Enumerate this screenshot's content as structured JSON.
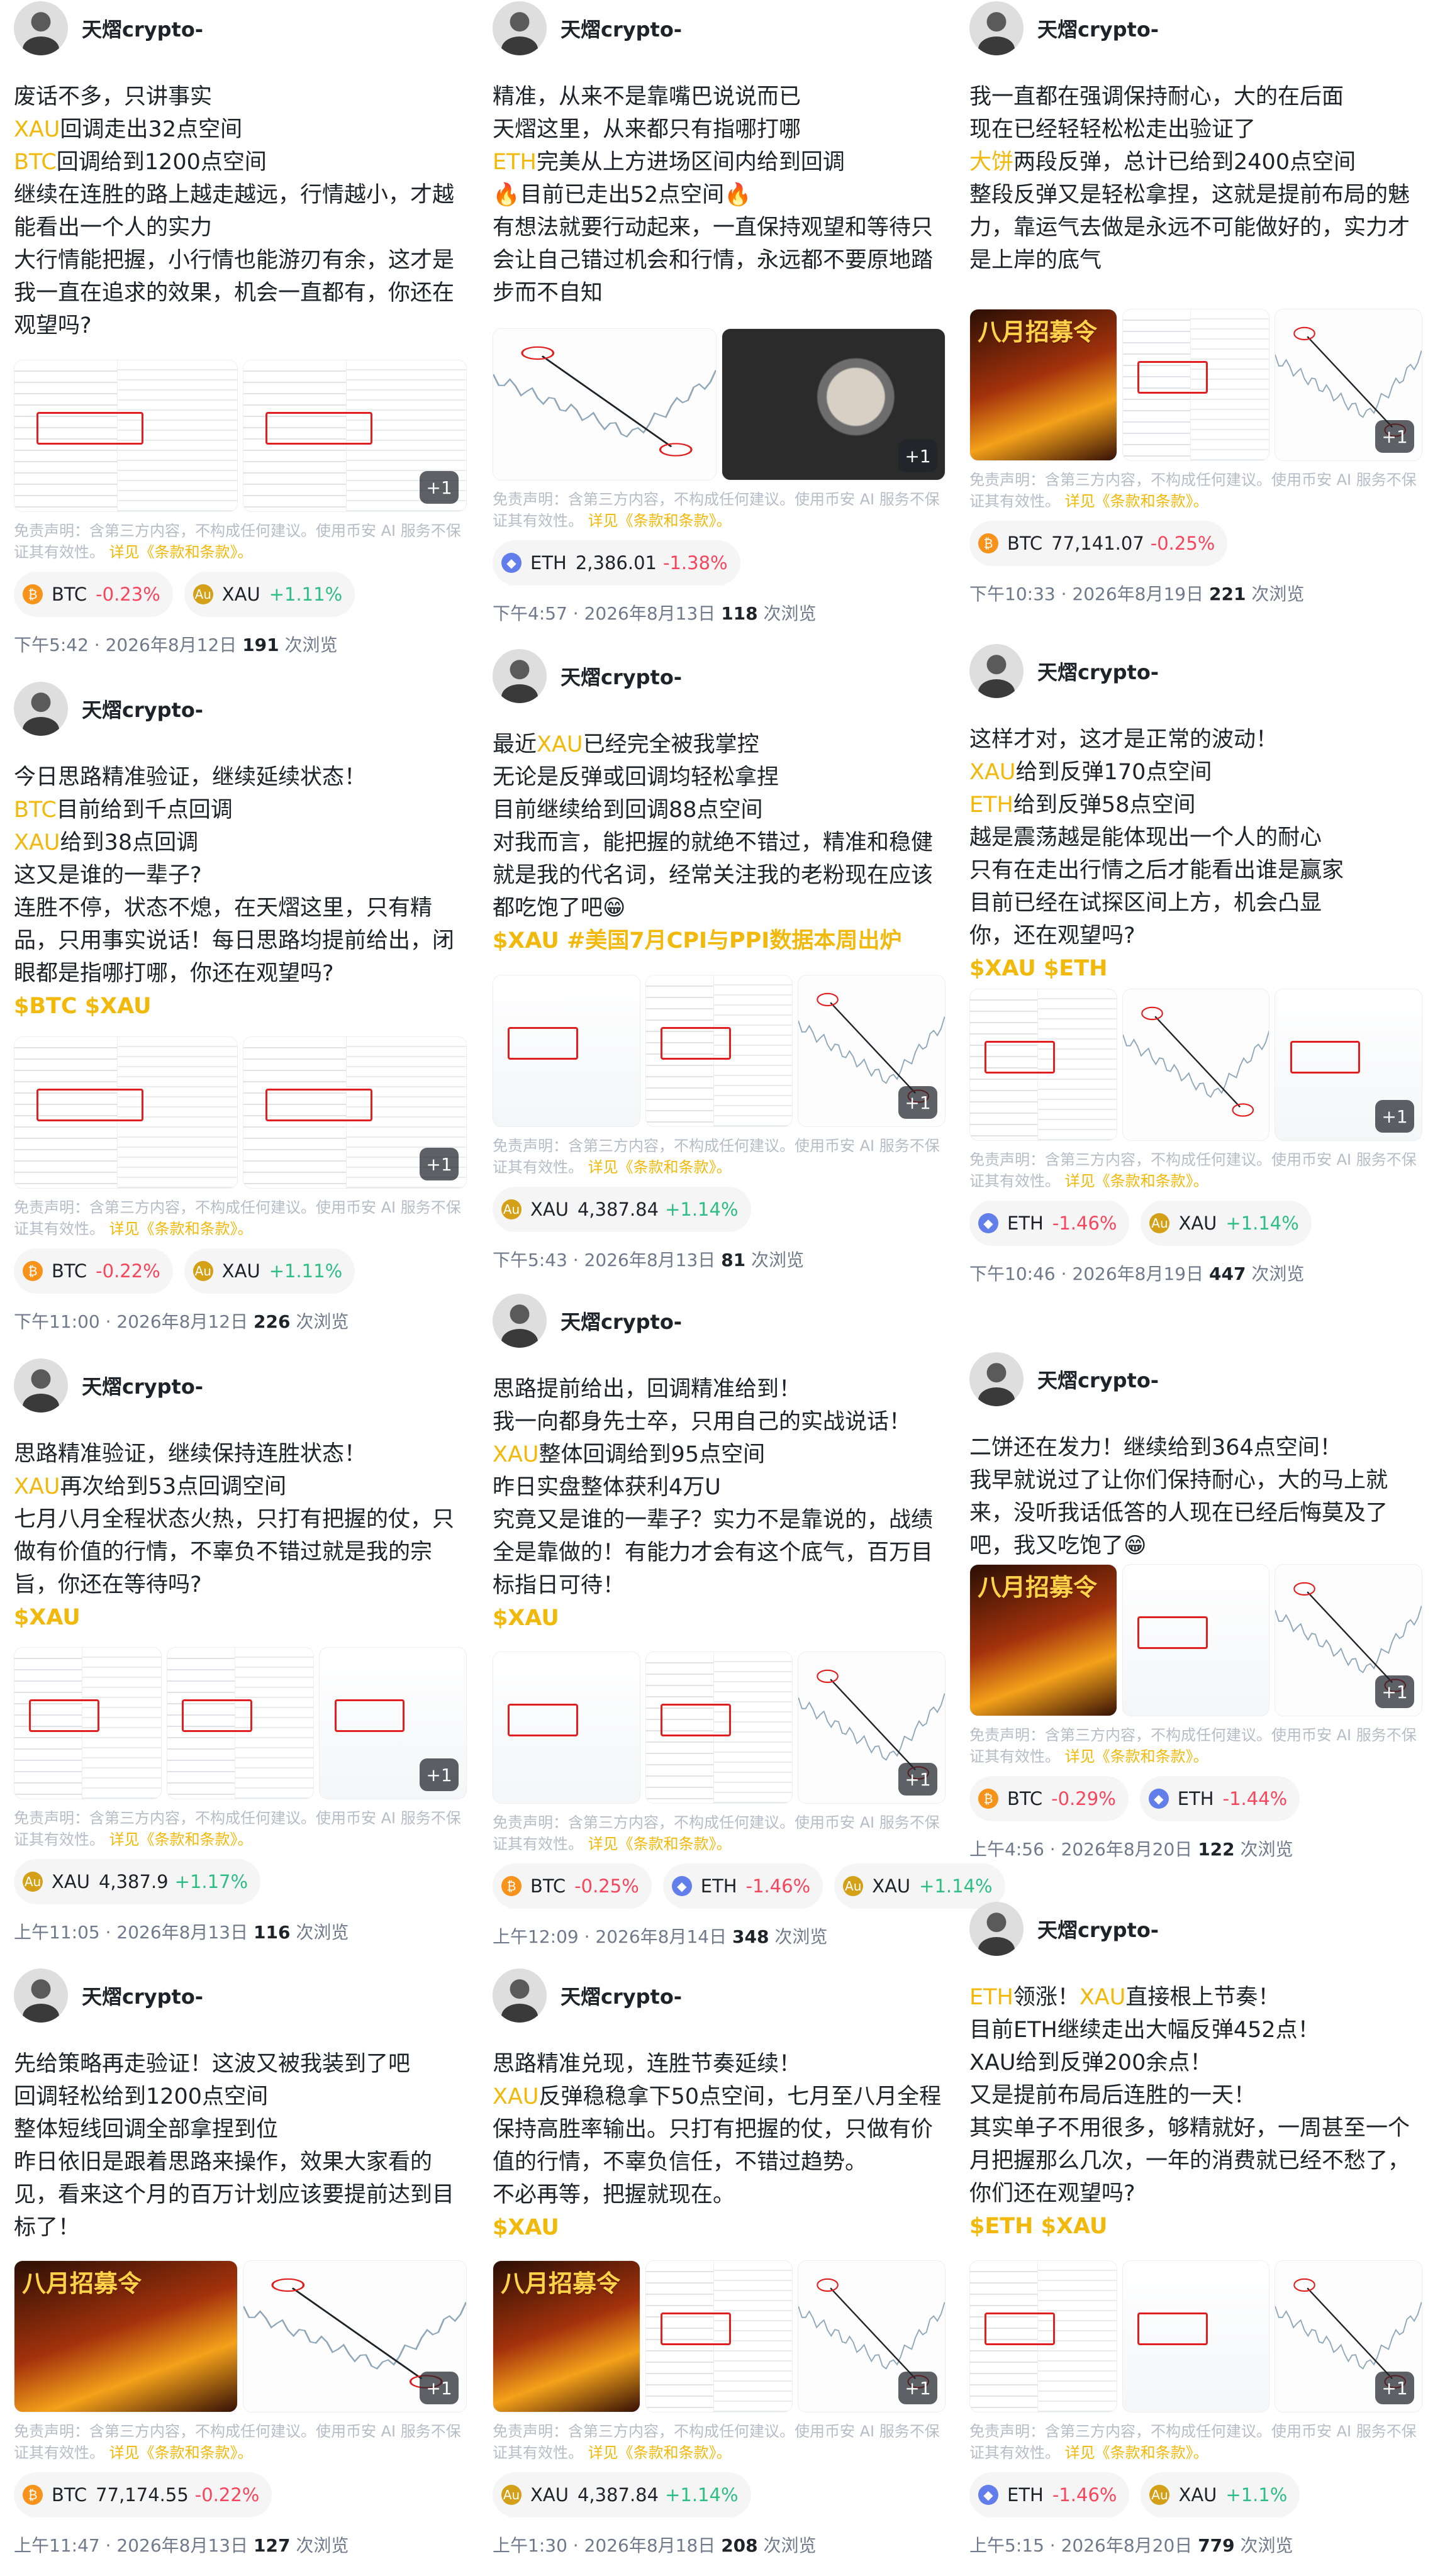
{
  "author": "天熠crypto-",
  "disclaimer": "免责声明：含第三方内容，不构成任何建议。使用币安 AI 服务不保证其有效性。",
  "terms_link": "详见《条款和条款》。",
  "views_suffix": "次浏览",
  "image_more": "+1",
  "poster_text": "八月招募令",
  "posts": [
    {
      "lines": [
        [
          {
            "t": "废话不多，只讲事实"
          }
        ],
        [
          {
            "t": "XAU",
            "c": "hl"
          },
          {
            "t": "回调走出32点空间"
          }
        ],
        [
          {
            "t": "BTC",
            "c": "hl"
          },
          {
            "t": "回调给到1200点空间"
          }
        ],
        [
          {
            "t": "继续在连胜的路上越走越远，行情越小，才越能看出一个人的实力"
          }
        ],
        [
          {
            "t": "大行情能把握，小行情也能游刃有余，这才是我一直在追求的效果，机会一直都有，你还在观望吗?"
          }
        ]
      ],
      "coins": [
        {
          "sym": "BTC",
          "type": "btc",
          "price": "",
          "change": "-0.23%"
        },
        {
          "sym": "XAU",
          "type": "xau",
          "price": "",
          "change": "+1.11%"
        }
      ],
      "time": "下午5:42 · 2026年8月12日",
      "views": "191"
    },
    {
      "lines": [
        [
          {
            "t": "今日思路精准验证，继续延续状态！"
          }
        ],
        [
          {
            "t": "BTC",
            "c": "hl"
          },
          {
            "t": "目前给到千点回调"
          }
        ],
        [
          {
            "t": "XAU",
            "c": "hl"
          },
          {
            "t": "给到38点回调"
          }
        ],
        [
          {
            "t": "这又是谁的一辈子?"
          }
        ],
        [
          {
            "t": "连胜不停，状态不熄，在天熠这里，只有精品，只用事实说话！每日思路均提前给出，闭眼都是指哪打哪，你还在观望吗?"
          }
        ],
        [
          {
            "t": "$BTC $XAU",
            "c": "tag"
          }
        ]
      ],
      "coins": [
        {
          "sym": "BTC",
          "type": "btc",
          "price": "",
          "change": "-0.22%"
        },
        {
          "sym": "XAU",
          "type": "xau",
          "price": "",
          "change": "+1.11%"
        }
      ],
      "time": "下午11:00 · 2026年8月12日",
      "views": "226"
    },
    {
      "lines": [
        [
          {
            "t": "思路精准验证，继续保持连胜状态！"
          }
        ],
        [
          {
            "t": "XAU",
            "c": "hl"
          },
          {
            "t": "再次给到53点回调空间"
          }
        ],
        [
          {
            "t": "七月八月全程状态火热，只打有把握的仗，只做有价值的行情，不辜负不错过就是我的宗旨，你还在等待吗?"
          }
        ],
        [
          {
            "t": "$XAU",
            "c": "tag"
          }
        ]
      ],
      "coins": [
        {
          "sym": "XAU",
          "type": "xau",
          "price": "4,387.9",
          "change": "+1.17%"
        }
      ],
      "time": "上午11:05 · 2026年8月13日",
      "views": "116"
    },
    {
      "lines": [
        [
          {
            "t": "先给策略再走验证！这波又被我装到了吧"
          }
        ],
        [
          {
            "t": "回调轻松给到1200点空间"
          }
        ],
        [
          {
            "t": "整体短线回调全部拿捏到位"
          }
        ],
        [
          {
            "t": "昨日依旧是跟着思路来操作，效果大家看的见，看来这个月的百万计划应该要提前达到目标了！"
          }
        ]
      ],
      "coins": [
        {
          "sym": "BTC",
          "type": "btc",
          "price": "77,174.55",
          "change": "-0.22%"
        }
      ],
      "time": "上午11:47 · 2026年8月13日",
      "views": "127"
    },
    {
      "lines": [
        [
          {
            "t": "精准，从来不是靠嘴巴说说而已"
          }
        ],
        [
          {
            "t": "天熠这里，从来都只有指哪打哪"
          }
        ],
        [
          {
            "t": "ETH",
            "c": "hl"
          },
          {
            "t": "完美从上方进场区间内给到回调"
          }
        ],
        [
          {
            "t": "🔥目前已走出52点空间🔥"
          }
        ],
        [
          {
            "t": "有想法就要行动起来，一直保持观望和等待只会让自己错过机会和行情，永远都不要原地踏步而不自知"
          }
        ]
      ],
      "coins": [
        {
          "sym": "ETH",
          "type": "eth",
          "price": "2,386.01",
          "change": "-1.38%"
        }
      ],
      "time": "下午4:57 · 2026年8月13日",
      "views": "118"
    },
    {
      "lines": [
        [
          {
            "t": "最近"
          },
          {
            "t": "XAU",
            "c": "hl"
          },
          {
            "t": "已经完全被我掌控"
          }
        ],
        [
          {
            "t": "无论是反弹或回调均轻松拿捏"
          }
        ],
        [
          {
            "t": "目前继续给到回调88点空间"
          }
        ],
        [
          {
            "t": "对我而言，能把握的就绝不错过，精准和稳健就是我的代名词，经常关注我的老粉现在应该都吃饱了吧😁"
          }
        ],
        [
          {
            "t": "$XAU #美国7月CPI与PPI数据本周出炉",
            "c": "tag"
          }
        ]
      ],
      "coins": [
        {
          "sym": "XAU",
          "type": "xau",
          "price": "4,387.84",
          "change": "+1.14%"
        }
      ],
      "time": "下午5:43 · 2026年8月13日",
      "views": "81"
    },
    {
      "lines": [
        [
          {
            "t": "思路提前给出，回调精准给到！"
          }
        ],
        [
          {
            "t": "我一向都身先士卒，只用自己的实战说话！"
          }
        ],
        [
          {
            "t": "XAU",
            "c": "hl"
          },
          {
            "t": "整体回调给到95点空间"
          }
        ],
        [
          {
            "t": "昨日实盘整体获利4万U"
          }
        ],
        [
          {
            "t": "究竟又是谁的一辈子？实力不是靠说的，战绩全是靠做的！有能力才会有这个底气，百万目标指日可待！"
          }
        ],
        [
          {
            "t": "$XAU",
            "c": "tag"
          }
        ]
      ],
      "coins": [
        {
          "sym": "BTC",
          "type": "btc",
          "price": "",
          "change": "-0.25%"
        },
        {
          "sym": "ETH",
          "type": "eth",
          "price": "",
          "change": "-1.46%"
        },
        {
          "sym": "XAU",
          "type": "xau",
          "price": "",
          "change": "+1.14%"
        }
      ],
      "time": "上午12:09 · 2026年8月14日",
      "views": "348"
    },
    {
      "lines": [
        [
          {
            "t": "思路精准兑现，连胜节奏延续！"
          }
        ],
        [
          {
            "t": "XAU",
            "c": "hl"
          },
          {
            "t": "反弹稳稳拿下50点空间，七月至八月全程保持高胜率输出。只打有把握的仗，只做有价值的行情，不辜负信任，不错过趋势。"
          }
        ],
        [
          {
            "t": "不必再等，把握就现在。"
          }
        ],
        [
          {
            "t": "$XAU",
            "c": "tag"
          }
        ]
      ],
      "coins": [
        {
          "sym": "XAU",
          "type": "xau",
          "price": "4,387.84",
          "change": "+1.14%"
        }
      ],
      "time": "上午1:30 · 2026年8月18日",
      "views": "208"
    },
    {
      "lines": [
        [
          {
            "t": "我一直都在强调保持耐心，大的在后面"
          }
        ],
        [
          {
            "t": "现在已经轻轻松松走出验证了"
          }
        ],
        [
          {
            "t": "大饼",
            "c": "hl"
          },
          {
            "t": "两段反弹，总计已给到2400点空间"
          }
        ],
        [
          {
            "t": "整段反弹又是轻松拿捏，这就是提前布局的魅力，靠运气去做是永远不可能做好的，实力才是上岸的底气"
          }
        ]
      ],
      "coins": [
        {
          "sym": "BTC",
          "type": "btc",
          "price": "77,141.07",
          "change": "-0.25%"
        }
      ],
      "time": "下午10:33 · 2026年8月19日",
      "views": "221"
    },
    {
      "lines": [
        [
          {
            "t": "这样才对，这才是正常的波动！"
          }
        ],
        [
          {
            "t": "XAU",
            "c": "hl"
          },
          {
            "t": "给到反弹170点空间"
          }
        ],
        [
          {
            "t": "ETH",
            "c": "hl"
          },
          {
            "t": "给到反弹58点空间"
          }
        ],
        [
          {
            "t": "越是震荡越是能体现出一个人的耐心"
          }
        ],
        [
          {
            "t": "只有在走出行情之后才能看出谁是赢家"
          }
        ],
        [
          {
            "t": "目前已经在试探区间上方，机会凸显"
          }
        ],
        [
          {
            "t": "你，还在观望吗?"
          }
        ],
        [
          {
            "t": "$XAU $ETH",
            "c": "tag"
          }
        ]
      ],
      "coins": [
        {
          "sym": "ETH",
          "type": "eth",
          "price": "",
          "change": "-1.46%"
        },
        {
          "sym": "XAU",
          "type": "xau",
          "price": "",
          "change": "+1.14%"
        }
      ],
      "time": "下午10:46 · 2026年8月19日",
      "views": "447"
    },
    {
      "lines": [
        [
          {
            "t": "二饼还在发力！继续给到364点空间！"
          }
        ],
        [
          {
            "t": "我早就说过了让你们保持耐心，大的马上就来，没听我话低答的人现在已经后悔莫及了吧，我又吃饱了😁"
          }
        ]
      ],
      "coins": [
        {
          "sym": "BTC",
          "type": "btc",
          "price": "",
          "change": "-0.29%"
        },
        {
          "sym": "ETH",
          "type": "eth",
          "price": "",
          "change": "-1.44%"
        }
      ],
      "time": "上午4:56 · 2026年8月20日",
      "views": "122"
    },
    {
      "lines": [
        [
          {
            "t": "ETH",
            "c": "hl"
          },
          {
            "t": "领涨！"
          },
          {
            "t": "XAU",
            "c": "hl"
          },
          {
            "t": "直接根上节奏！"
          }
        ],
        [
          {
            "t": "目前ETH继续走出大幅反弹452点！"
          }
        ],
        [
          {
            "t": "XAU给到反弹200余点！"
          }
        ],
        [
          {
            "t": "又是提前布局后连胜的一天！"
          }
        ],
        [
          {
            "t": "其实单子不用很多，够精就好，一周甚至一个月把握那么几次，一年的消费就已经不愁了，你们还在观望吗?"
          }
        ],
        [
          {
            "t": "$ETH $XAU",
            "c": "tag"
          }
        ]
      ],
      "coins": [
        {
          "sym": "ETH",
          "type": "eth",
          "price": "",
          "change": "-1.46%"
        },
        {
          "sym": "XAU",
          "type": "xau",
          "price": "",
          "change": "+1.1%"
        }
      ],
      "time": "上午5:15 · 2026年8月20日",
      "views": "779"
    }
  ]
}
